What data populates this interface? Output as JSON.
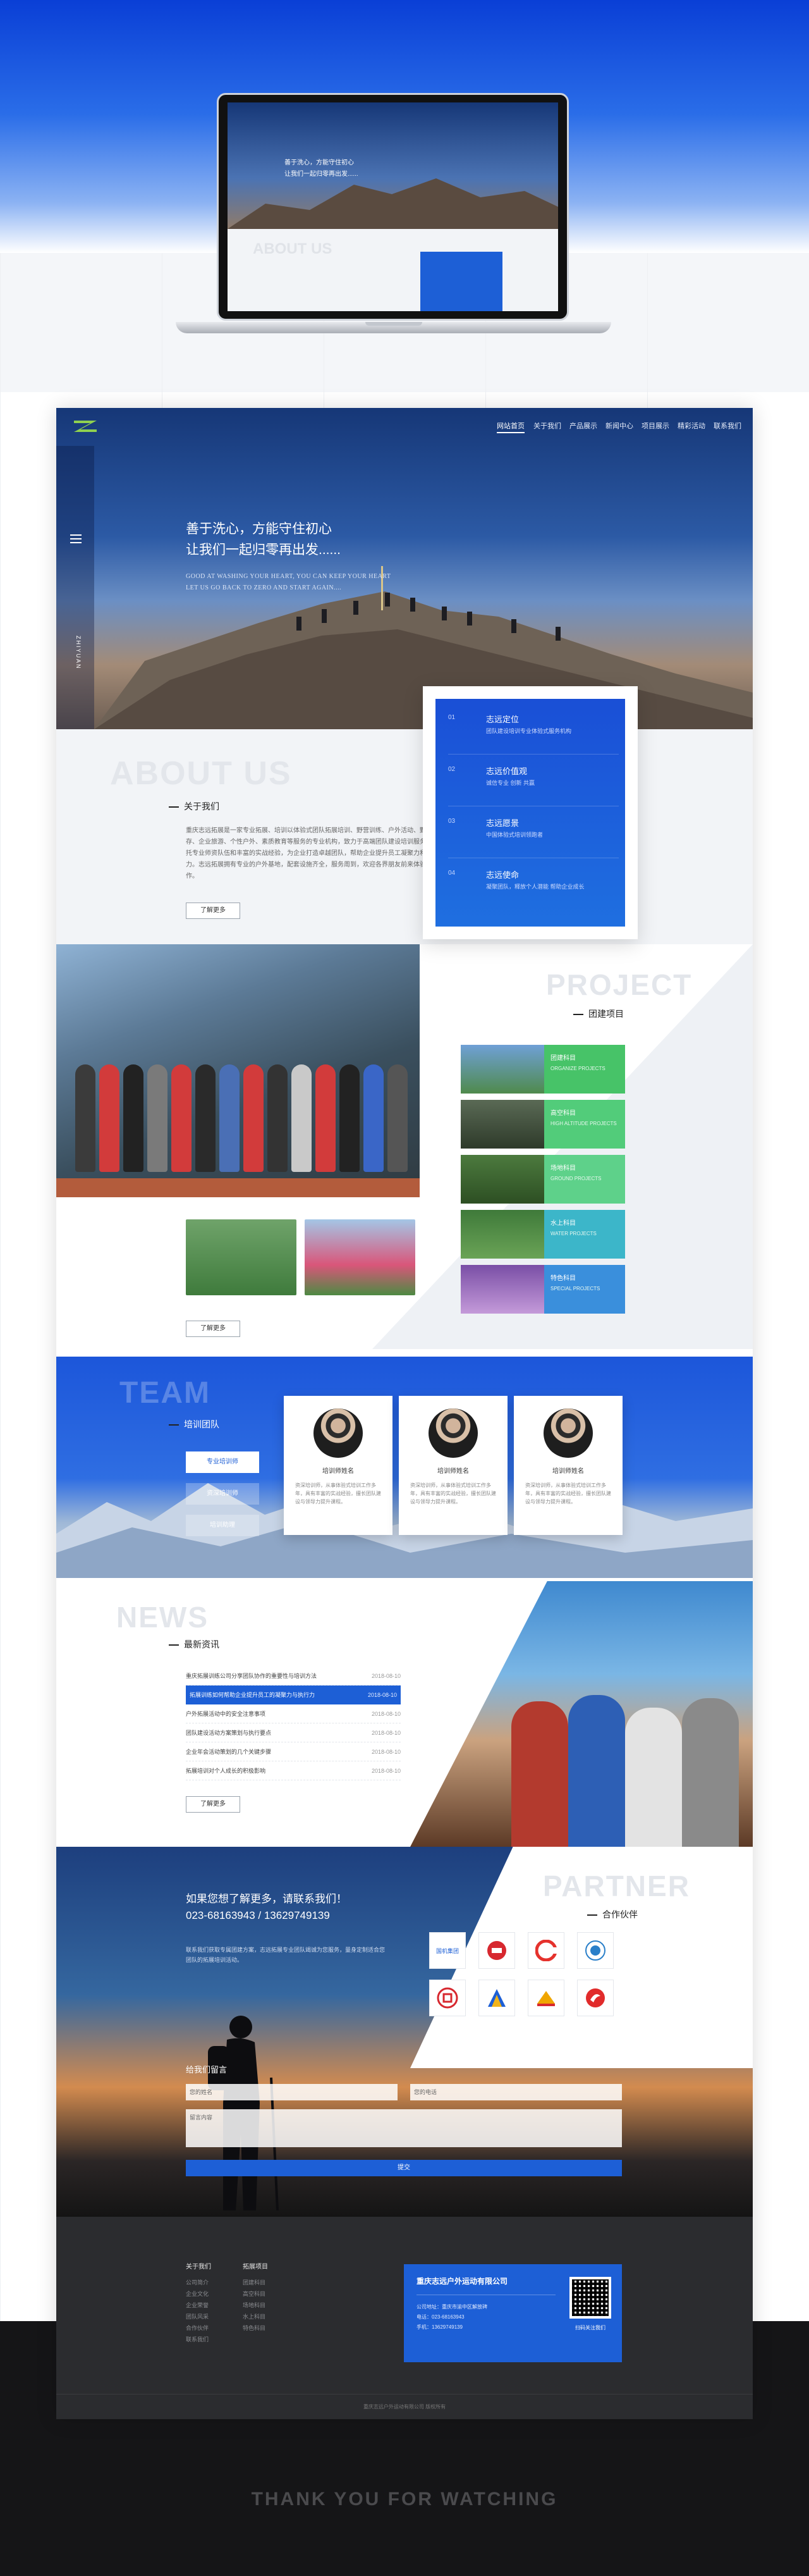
{
  "nav": {
    "items": [
      "网站首页",
      "关于我们",
      "产品展示",
      "新闻中心",
      "项目展示",
      "精彩活动",
      "联系我们"
    ]
  },
  "laptop": {
    "hero_line1": "善于洗心，方能守住初心",
    "hero_line2": "让我们一起归零再出发......",
    "about_en": "ABOUT US"
  },
  "hero": {
    "title_line1": "善于洗心，方能守住初心",
    "title_line2": "让我们一起归零再出发......",
    "sub_line1": "GOOD AT WASHING YOUR HEART, YOU CAN KEEP YOUR HEART",
    "sub_line2": "LET US GO BACK TO ZERO AND START AGAIN....",
    "side_text": "ZHIYUAN"
  },
  "about": {
    "en": "ABOUT US",
    "title": "关于我们",
    "text": "重庆志远拓展是一家专业拓展、培训以体验式团队拓展培训、野营训练、户外活动、野外生存、企业旅游、个性户外、素质教育等服务的专业机构，致力于高端团队建设培训服务。依托专业师资队伍和丰富的实战经验，为企业打造卓越团队，帮助企业提升员工凝聚力和执行力。志远拓展拥有专业的户外基地，配套设施齐全，服务周到，欢迎各界朋友前来体验合作。",
    "button": "了解更多",
    "cards": [
      {
        "num": "01",
        "title": "志远定位",
        "desc": "团队建设培训专业体验式服务机构"
      },
      {
        "num": "02",
        "title": "志远价值观",
        "desc": "诚信专业 创新 共赢"
      },
      {
        "num": "03",
        "title": "志远愿景",
        "desc": "中国体验式培训领跑者"
      },
      {
        "num": "04",
        "title": "志远使命",
        "desc": "凝聚团队，释放个人潜能 帮助企业成长"
      }
    ]
  },
  "project": {
    "en": "PROJECT",
    "title": "团建项目",
    "button": "了解更多",
    "items": [
      {
        "name": "团建科目",
        "en": "ORGANIZE PROJECTS",
        "color": "#47c368"
      },
      {
        "name": "高空科目",
        "en": "HIGH ALTITUDE PROJECTS",
        "color": "#52cc7a"
      },
      {
        "name": "场地科目",
        "en": "GROUND PROJECTS",
        "color": "#5ed18a"
      },
      {
        "name": "水上科目",
        "en": "WATER PROJECTS",
        "color": "#3cb6c9"
      },
      {
        "name": "特色科目",
        "en": "SPECIAL PROJECTS",
        "color": "#3a8fdc"
      }
    ]
  },
  "team": {
    "en": "TEAM",
    "title": "培训团队",
    "buttons": [
      "专业培训师",
      "资深培训师",
      "培训助理"
    ],
    "members": [
      {
        "name": "培训师姓名",
        "desc": "资深培训师，从事体验式培训工作多年，具有丰富的实战经验，擅长团队建设与领导力提升课程。"
      },
      {
        "name": "培训师姓名",
        "desc": "资深培训师，从事体验式培训工作多年，具有丰富的实战经验，擅长团队建设与领导力提升课程。"
      },
      {
        "name": "培训师姓名",
        "desc": "资深培训师，从事体验式培训工作多年，具有丰富的实战经验，擅长团队建设与领导力提升课程。"
      }
    ]
  },
  "news": {
    "en": "NEWS",
    "title": "最新资讯",
    "button": "了解更多",
    "items": [
      {
        "title": "重庆拓展训练公司分享团队协作的重要性与培训方法",
        "date": "2018-08-10"
      },
      {
        "title": "拓展训练如何帮助企业提升员工的凝聚力与执行力",
        "date": "2018-08-10"
      },
      {
        "title": "户外拓展活动中的安全注意事项",
        "date": "2018-08-10"
      },
      {
        "title": "团队建设活动方案策划与执行要点",
        "date": "2018-08-10"
      },
      {
        "title": "企业年会活动策划的几个关键步骤",
        "date": "2018-08-10"
      },
      {
        "title": "拓展培训对个人成长的积极影响",
        "date": "2018-08-10"
      }
    ]
  },
  "partner": {
    "en": "PARTNER",
    "title": "合作伙伴",
    "logos": [
      "国机集团",
      "",
      "",
      "",
      "",
      "",
      "",
      ""
    ]
  },
  "contact": {
    "line1": "如果您想了解更多，请联系我们！",
    "line2": "023-68163943 / 13629749139",
    "text": "联系我们获取专属团建方案，志远拓展专业团队竭诚为您服务，量身定制适合您团队的拓展培训活动。",
    "form_title": "给我们留言",
    "name_ph": "您的姓名",
    "phone_ph": "您的电话",
    "msg_ph": "留言内容",
    "submit": "提交"
  },
  "footer": {
    "col1_title": "关于我们",
    "col1": [
      "公司简介",
      "企业文化",
      "企业荣誉",
      "团队风采",
      "合作伙伴",
      "联系我们"
    ],
    "col2_title": "拓展项目",
    "col2": [
      "团建科目",
      "高空科目",
      "场地科目",
      "水上科目",
      "特色科目"
    ],
    "company": "重庆志远户外运动有限公司",
    "address": "公司地址：重庆市渝中区解放碑",
    "phone": "电话：023-68163943",
    "mobile": "手机：13629749139",
    "qr_label": "扫码关注我们",
    "copyright": "重庆志远户外运动有限公司 版权所有"
  },
  "thanks": "THANK YOU FOR WATCHING"
}
